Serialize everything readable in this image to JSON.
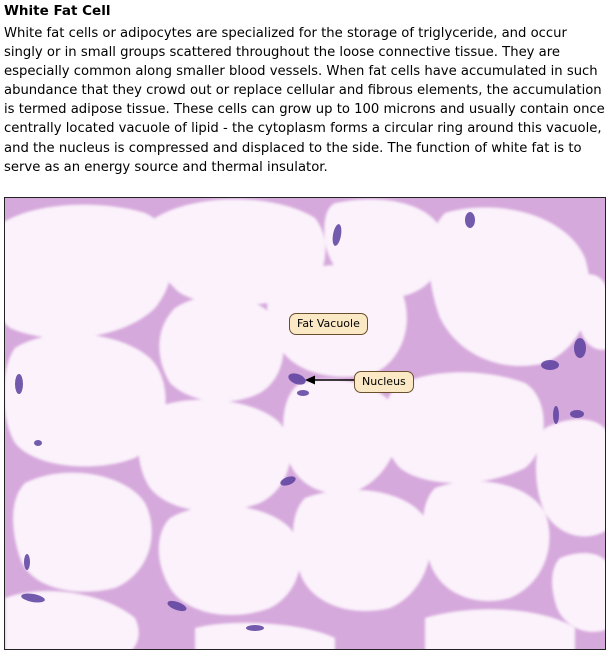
{
  "document": {
    "title": "White Fat Cell",
    "paragraph": "White fat cells or adipocytes are specialized for the storage of triglyceride, and occur singly or in small groups scattered throughout the loose connective tissue. They are especially common along smaller blood vessels. When fat cells have accumulated in such abundance that they crowd out or replace cellular and fibrous elements, the accumulation is termed adipose tissue. These cells can grow up to 100 microns and usually contain once centrally located vacuole of lipid - the cytoplasm forms a circular ring around this vacuole, and the nucleus is compressed and displaced to the side. The function of white fat is to serve as an energy source and thermal insulator."
  },
  "figure": {
    "labels": {
      "fat_vacuole": "Fat Vacuole",
      "nucleus": "Nucleus"
    },
    "colors": {
      "vacuole": "#fbf2fb",
      "connective_tissue": "#d6a9dc",
      "nucleus": "#5a3f9e",
      "callout_fill": "#fbe9c6"
    }
  }
}
